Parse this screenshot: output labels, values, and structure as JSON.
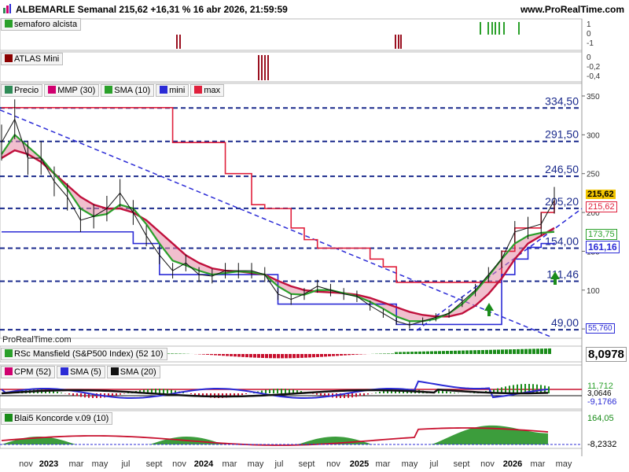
{
  "header": {
    "title": "ALBEMARLE Semanal 215,62 +16,31 % 16 abr 2026, 21:59:59",
    "site": "www.ProRealTime.com"
  },
  "panels": {
    "semaforo": {
      "label": "semaforo alcista",
      "ticks": [
        "1",
        "0",
        "-1"
      ]
    },
    "atlas": {
      "label": "ATLAS Mini",
      "ticks": [
        "0",
        "-0,2",
        "-0,4"
      ]
    },
    "price": {
      "legend": [
        "Precio",
        "MMP (30)",
        "SMA (10)",
        "mini",
        "max"
      ],
      "legend_colors": [
        "#2e8b57",
        "#d0006f",
        "#2aa02a",
        "#2b2bd6",
        "#e0203c"
      ],
      "y_ticks": [
        "350",
        "300",
        "250",
        "200",
        "150",
        "100",
        "50"
      ],
      "levels": [
        "334,50",
        "291,50",
        "246,50",
        "205,20",
        "154,00",
        "111,46",
        "49,00"
      ],
      "watermark": "ProRealTime.com",
      "right_labels": {
        "last": "215,62",
        "max": "215,62",
        "sma": "173,75",
        "mini": "161,16",
        "mini_low": "55,760"
      }
    },
    "rsc": {
      "label": "RSc Mansfield (S&P500 Index) (52 10)",
      "value": "8,0978"
    },
    "cpm": {
      "label": "CPM (52)",
      "sma5": "SMA (5)",
      "sma20": "SMA (20)",
      "values": [
        "11,712",
        "3,0646",
        "-9,1766"
      ]
    },
    "blai": {
      "label": "Blai5 Koncorde v.09 (10)",
      "values": [
        "164,05",
        "-8,2332"
      ]
    }
  },
  "x_axis": {
    "labels": [
      "nov",
      "2023",
      "mar",
      "may",
      "jul",
      "sept",
      "nov",
      "2024",
      "mar",
      "may",
      "jul",
      "sept",
      "nov",
      "2025",
      "mar",
      "may",
      "jul",
      "sept",
      "nov",
      "2026",
      "mar",
      "may"
    ],
    "bold": [
      false,
      true,
      false,
      false,
      false,
      false,
      false,
      true,
      false,
      false,
      false,
      false,
      false,
      true,
      false,
      false,
      false,
      false,
      false,
      true,
      false,
      false
    ]
  },
  "chart_data": {
    "type": "line",
    "title": "ALBEMARLE Semanal",
    "ylim": [
      40,
      350
    ],
    "x": [
      "2022-10",
      "2022-11",
      "2022-12",
      "2023-01",
      "2023-02",
      "2023-03",
      "2023-04",
      "2023-05",
      "2023-06",
      "2023-07",
      "2023-08",
      "2023-09",
      "2023-10",
      "2023-11",
      "2023-12",
      "2024-01",
      "2024-02",
      "2024-03",
      "2024-04",
      "2024-05",
      "2024-06",
      "2024-07",
      "2024-08",
      "2024-09",
      "2024-10",
      "2024-11",
      "2024-12",
      "2025-01",
      "2025-02",
      "2025-03",
      "2025-04",
      "2025-05",
      "2025-06",
      "2025-07",
      "2025-08",
      "2025-09",
      "2025-10",
      "2025-11",
      "2025-12",
      "2026-01",
      "2026-02",
      "2026-03",
      "2026-04"
    ],
    "series": [
      {
        "name": "Precio",
        "values": [
          290,
          320,
          270,
          270,
          240,
          220,
          190,
          195,
          205,
          225,
          200,
          170,
          145,
          125,
          135,
          120,
          118,
          125,
          125,
          125,
          120,
          95,
          88,
          95,
          105,
          100,
          95,
          92,
          80,
          70,
          60,
          55,
          60,
          65,
          70,
          85,
          100,
          120,
          140,
          175,
          180,
          185,
          215.62
        ]
      },
      {
        "name": "MMP (30)",
        "values": [
          270,
          280,
          275,
          265,
          250,
          235,
          220,
          210,
          205,
          205,
          200,
          190,
          175,
          160,
          145,
          135,
          128,
          125,
          124,
          122,
          120,
          112,
          105,
          100,
          98,
          97,
          96,
          94,
          90,
          84,
          78,
          72,
          68,
          66,
          66,
          70,
          80,
          95,
          115,
          140,
          160,
          170,
          180
        ]
      },
      {
        "name": "SMA (10)",
        "values": [
          275,
          300,
          285,
          270,
          250,
          230,
          205,
          195,
          198,
          210,
          205,
          185,
          160,
          138,
          132,
          125,
          120,
          122,
          124,
          123,
          120,
          105,
          95,
          94,
          100,
          100,
          96,
          92,
          85,
          76,
          66,
          60,
          60,
          63,
          70,
          82,
          98,
          118,
          140,
          160,
          170,
          173.75,
          175
        ]
      },
      {
        "name": "mini",
        "values": [
          175,
          175,
          175,
          175,
          175,
          175,
          175,
          175,
          175,
          175,
          160,
          160,
          120,
          120,
          120,
          120,
          120,
          120,
          120,
          120,
          120,
          82,
          82,
          82,
          82,
          82,
          82,
          82,
          82,
          82,
          55.76,
          55.76,
          55.76,
          55.76,
          55.76,
          55.76,
          55.76,
          55.76,
          120,
          140,
          155,
          160,
          161.16
        ]
      },
      {
        "name": "max",
        "values": [
          335,
          335,
          335,
          335,
          335,
          335,
          335,
          335,
          335,
          335,
          335,
          335,
          335,
          290,
          290,
          290,
          290,
          250,
          250,
          210,
          205,
          205,
          180,
          165,
          154,
          154,
          154,
          154,
          140,
          130,
          110,
          110,
          110,
          110,
          110,
          110,
          110,
          110,
          150,
          180,
          180,
          200,
          215.62
        ]
      }
    ]
  }
}
